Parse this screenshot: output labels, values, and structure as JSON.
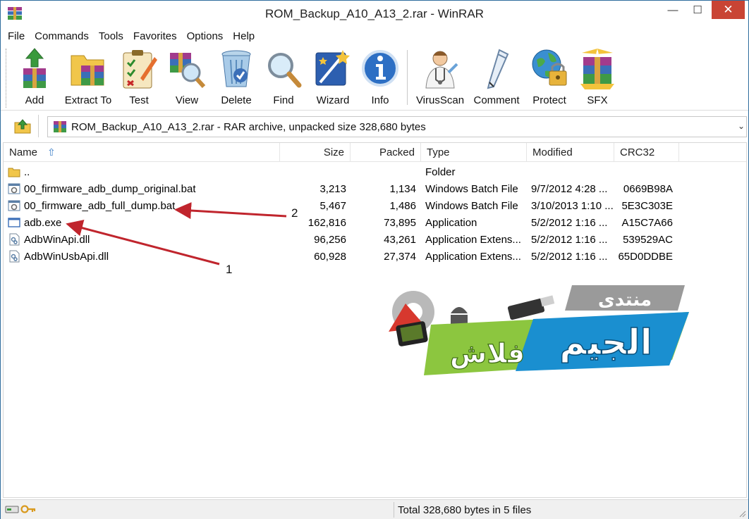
{
  "window": {
    "title": "ROM_Backup_A10_A13_2.rar - WinRAR",
    "minimize_glyph": "—",
    "maximize_glyph": "☐",
    "close_glyph": "✕"
  },
  "menu": [
    "File",
    "Commands",
    "Tools",
    "Favorites",
    "Options",
    "Help"
  ],
  "toolbar": [
    {
      "label": "Add",
      "icon": "add-archive-icon"
    },
    {
      "label": "Extract To",
      "icon": "extract-to-icon"
    },
    {
      "label": "Test",
      "icon": "test-clipboard-icon"
    },
    {
      "label": "View",
      "icon": "view-magnifier-icon"
    },
    {
      "label": "Delete",
      "icon": "trash-bin-icon"
    },
    {
      "label": "Find",
      "icon": "find-magnifier-icon"
    },
    {
      "label": "Wizard",
      "icon": "wizard-wand-icon"
    },
    {
      "label": "Info",
      "icon": "info-icon"
    },
    {
      "label": "VirusScan",
      "icon": "doctor-icon"
    },
    {
      "label": "Comment",
      "icon": "pen-icon"
    },
    {
      "label": "Protect",
      "icon": "globe-lock-icon"
    },
    {
      "label": "SFX",
      "icon": "sfx-box-icon"
    }
  ],
  "address": {
    "text": "ROM_Backup_A10_A13_2.rar - RAR archive, unpacked size 328,680 bytes"
  },
  "columns": {
    "name": "Name",
    "size": "Size",
    "packed": "Packed",
    "type": "Type",
    "modified": "Modified",
    "crc": "CRC32"
  },
  "files": [
    {
      "name": "..",
      "size": "",
      "packed": "",
      "type": "Folder",
      "modified": "",
      "crc": "",
      "icon": "folder-icon"
    },
    {
      "name": "00_firmware_adb_dump_original.bat",
      "size": "3,213",
      "packed": "1,134",
      "type": "Windows Batch File",
      "modified": "9/7/2012 4:28 ...",
      "crc": "0669B98A",
      "icon": "batch-file-icon"
    },
    {
      "name": "00_firmware_adb_full_dump.bat",
      "size": "5,467",
      "packed": "1,486",
      "type": "Windows Batch File",
      "modified": "3/10/2013 1:10 ...",
      "crc": "5E3C303E",
      "icon": "batch-file-icon"
    },
    {
      "name": "adb.exe",
      "size": "162,816",
      "packed": "73,895",
      "type": "Application",
      "modified": "5/2/2012 1:16 ...",
      "crc": "A15C7A66",
      "icon": "exe-file-icon"
    },
    {
      "name": "AdbWinApi.dll",
      "size": "96,256",
      "packed": "43,261",
      "type": "Application Extens...",
      "modified": "5/2/2012 1:16 ...",
      "crc": "539529AC",
      "icon": "dll-file-icon"
    },
    {
      "name": "AdbWinUsbApi.dll",
      "size": "60,928",
      "packed": "27,374",
      "type": "Application Extens...",
      "modified": "5/2/2012 1:16 ...",
      "crc": "65D0DDBE",
      "icon": "dll-file-icon"
    }
  ],
  "annotations": {
    "label_1": "1",
    "label_2": "2",
    "arrow_color": "#c0252d"
  },
  "logo": {
    "top_text": "منتدى",
    "main_text": "الجيم",
    "sub_text": "فلاش"
  },
  "status": {
    "text": "Total 328,680 bytes in 5 files"
  },
  "colors": {
    "accent": "#3c7fc8",
    "close": "#c94434"
  }
}
